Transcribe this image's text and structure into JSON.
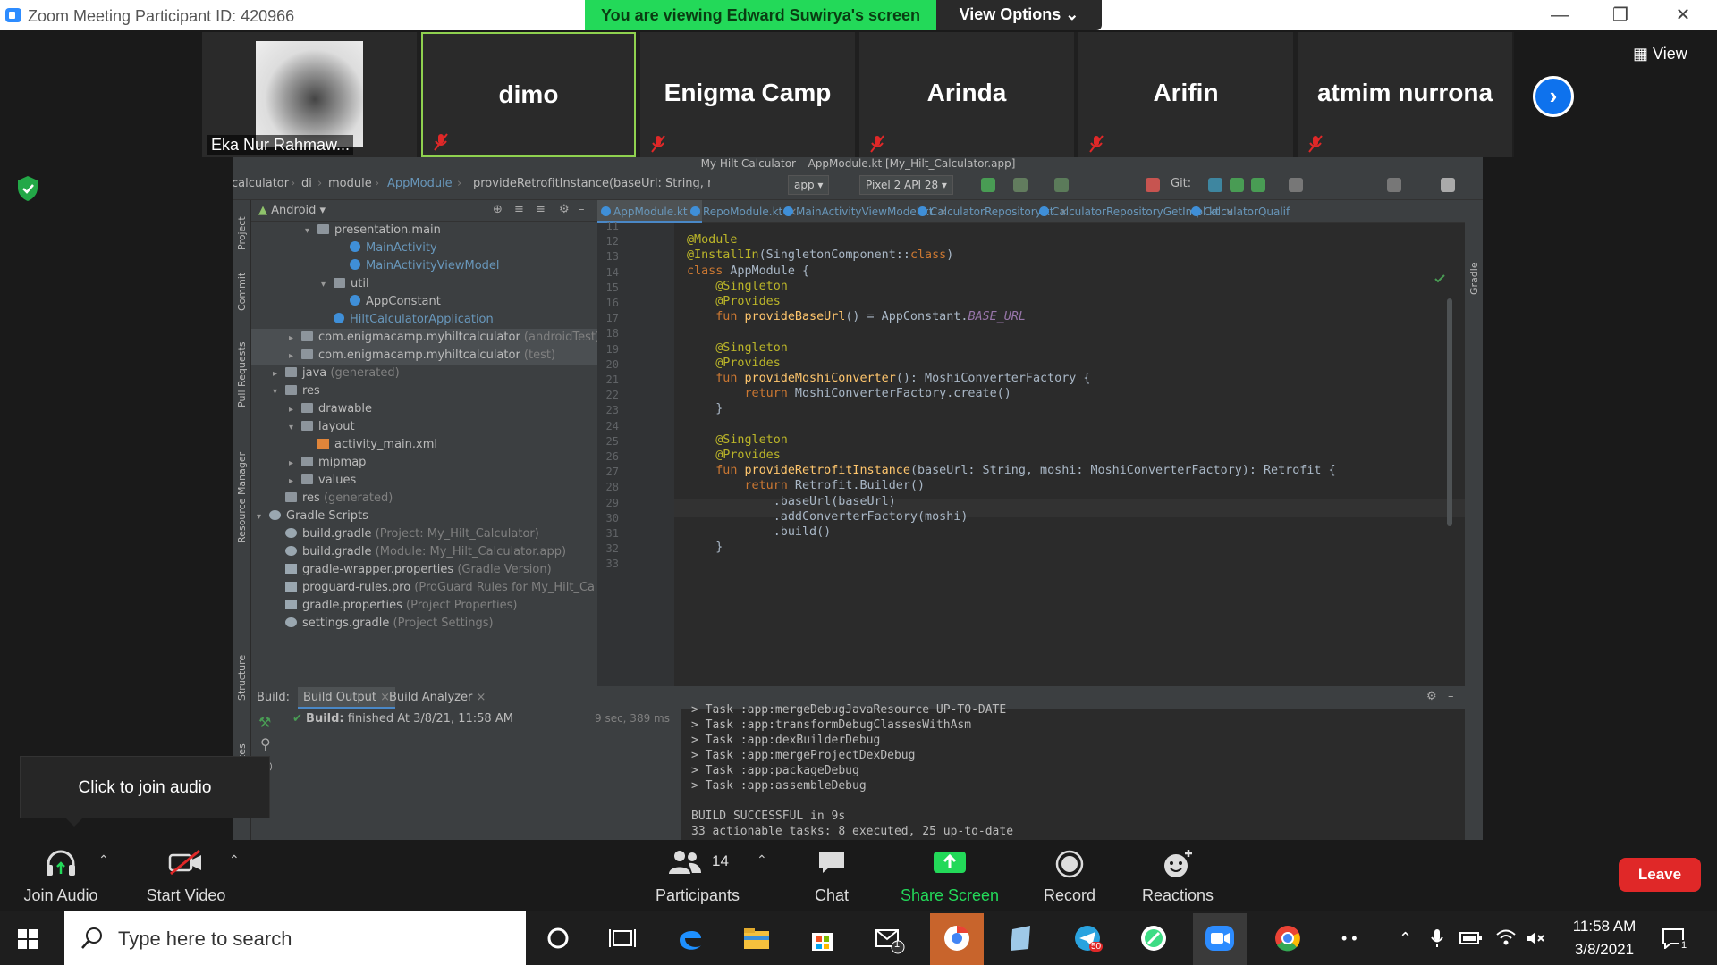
{
  "window": {
    "title": "Zoom Meeting Participant ID: 420966",
    "viewing_banner": "You are viewing Edward Suwirya's screen",
    "view_options": "View Options ⌄",
    "min": "—",
    "max": "❐",
    "close": "✕"
  },
  "participants": [
    {
      "name": "Eka Nur Rahmaw..."
    },
    {
      "name": "dimo"
    },
    {
      "name": "Enigma Camp"
    },
    {
      "name": "Arinda"
    },
    {
      "name": "Arifin"
    },
    {
      "name": "atmim nurrona"
    }
  ],
  "view_button": "View",
  "ide": {
    "title": "My Hilt Calculator – AppModule.kt [My_Hilt_Calculator.app]",
    "breadcrumbs": [
      "calculator",
      "di",
      "module",
      "AppModule",
      "provideRetrofitInstance(baseUrl: String, moshi:..."
    ],
    "run_config": "app",
    "device": "Pixel 2 API 28",
    "git_label": "Git:",
    "project_view": "Android",
    "tree": [
      {
        "label": "presentation.main",
        "note": "",
        "indent": 3,
        "arrow": "▾",
        "icon": "folder",
        "kt": false,
        "sel": false
      },
      {
        "label": "MainActivity",
        "note": "",
        "indent": 5,
        "arrow": "",
        "icon": "class",
        "kt": true,
        "sel": false
      },
      {
        "label": "MainActivityViewModel",
        "note": "",
        "indent": 5,
        "arrow": "",
        "icon": "class",
        "kt": true,
        "sel": false
      },
      {
        "label": "util",
        "note": "",
        "indent": 4,
        "arrow": "▾",
        "icon": "folder",
        "kt": false,
        "sel": false
      },
      {
        "label": "AppConstant",
        "note": "",
        "indent": 5,
        "arrow": "",
        "icon": "class",
        "kt": false,
        "sel": false
      },
      {
        "label": "HiltCalculatorApplication",
        "note": "",
        "indent": 4,
        "arrow": "",
        "icon": "class",
        "kt": true,
        "sel": false
      },
      {
        "label": "com.enigmacamp.myhiltcalculator",
        "note": " (androidTest)",
        "indent": 2,
        "arrow": "▸",
        "icon": "folder",
        "kt": false,
        "sel": true
      },
      {
        "label": "com.enigmacamp.myhiltcalculator",
        "note": " (test)",
        "indent": 2,
        "arrow": "▸",
        "icon": "folder",
        "kt": false,
        "sel": true
      },
      {
        "label": "java",
        "note": " (generated)",
        "indent": 1,
        "arrow": "▸",
        "icon": "folder",
        "kt": false,
        "sel": false
      },
      {
        "label": "res",
        "note": "",
        "indent": 1,
        "arrow": "▾",
        "icon": "folder",
        "kt": false,
        "sel": false
      },
      {
        "label": "drawable",
        "note": "",
        "indent": 2,
        "arrow": "▸",
        "icon": "folder",
        "kt": false,
        "sel": false
      },
      {
        "label": "layout",
        "note": "",
        "indent": 2,
        "arrow": "▾",
        "icon": "folder",
        "kt": false,
        "sel": false
      },
      {
        "label": "activity_main.xml",
        "note": "",
        "indent": 3,
        "arrow": "",
        "icon": "xml",
        "kt": false,
        "sel": false
      },
      {
        "label": "mipmap",
        "note": "",
        "indent": 2,
        "arrow": "▸",
        "icon": "folder",
        "kt": false,
        "sel": false
      },
      {
        "label": "values",
        "note": "",
        "indent": 2,
        "arrow": "▸",
        "icon": "folder",
        "kt": false,
        "sel": false
      },
      {
        "label": "res",
        "note": " (generated)",
        "indent": 1,
        "arrow": "",
        "icon": "folder",
        "kt": false,
        "sel": false
      },
      {
        "label": "Gradle Scripts",
        "note": "",
        "indent": 0,
        "arrow": "▾",
        "icon": "gradle",
        "kt": false,
        "sel": false
      },
      {
        "label": "build.gradle",
        "note": " (Project: My_Hilt_Calculator)",
        "indent": 1,
        "arrow": "",
        "icon": "gradle",
        "kt": false,
        "sel": false
      },
      {
        "label": "build.gradle",
        "note": " (Module: My_Hilt_Calculator.app)",
        "indent": 1,
        "arrow": "",
        "icon": "gradle",
        "kt": false,
        "sel": false
      },
      {
        "label": "gradle-wrapper.properties",
        "note": " (Gradle Version)",
        "indent": 1,
        "arrow": "",
        "icon": "props",
        "kt": false,
        "sel": false
      },
      {
        "label": "proguard-rules.pro",
        "note": " (ProGuard Rules for My_Hilt_Ca",
        "indent": 1,
        "arrow": "",
        "icon": "props",
        "kt": false,
        "sel": false
      },
      {
        "label": "gradle.properties",
        "note": " (Project Properties)",
        "indent": 1,
        "arrow": "",
        "icon": "props",
        "kt": false,
        "sel": false
      },
      {
        "label": "settings.gradle",
        "note": " (Project Settings)",
        "indent": 1,
        "arrow": "",
        "icon": "gradle",
        "kt": false,
        "sel": false
      }
    ],
    "tabs": [
      "AppModule.kt",
      "RepoModule.kt",
      "MainActivityViewModel.kt",
      "CalculatorRepository.kt",
      "CalculatorRepositoryGetImpl.kt",
      "CalculatorQualif"
    ],
    "code": [
      {
        "n": "11",
        "html": ""
      },
      {
        "n": "12",
        "html": "<span class='an'>@Module</span>"
      },
      {
        "n": "13",
        "html": "<span class='an'>@InstallIn</span>(SingletonComponent::<span class='kw'>class</span>)"
      },
      {
        "n": "14",
        "html": "<span class='kw'>class</span> AppModule {"
      },
      {
        "n": "15",
        "html": "    <span class='an'>@Singleton</span>"
      },
      {
        "n": "16",
        "html": "    <span class='an'>@Provides</span>"
      },
      {
        "n": "17",
        "html": "    <span class='kw'>fun</span> <span class='fn'>provideBaseUrl</span>() = AppConstant.<span class='cn'>BASE_URL</span>"
      },
      {
        "n": "18",
        "html": ""
      },
      {
        "n": "19",
        "html": "    <span class='an'>@Singleton</span>"
      },
      {
        "n": "20",
        "html": "    <span class='an'>@Provides</span>"
      },
      {
        "n": "21",
        "html": "    <span class='kw'>fun</span> <span class='fn'>provideMoshiConverter</span>(): MoshiConverterFactory {"
      },
      {
        "n": "22",
        "html": "        <span class='kw'>return</span> MoshiConverterFactory.create()"
      },
      {
        "n": "23",
        "html": "    }"
      },
      {
        "n": "24",
        "html": ""
      },
      {
        "n": "25",
        "html": "    <span class='an'>@Singleton</span>"
      },
      {
        "n": "26",
        "html": "    <span class='an'>@Provides</span>"
      },
      {
        "n": "27",
        "html": "    <span class='kw'>fun</span> <span class='fn'>provideRetrofitInstance</span>(baseUrl: String, moshi: MoshiConverterFactory): Retrofit {"
      },
      {
        "n": "28",
        "html": "        <span class='kw'>return</span> Retrofit.Builder()"
      },
      {
        "n": "29",
        "html": "            .baseUrl(baseUrl)"
      },
      {
        "n": "30",
        "html": "            .addConverterFactory(moshi)"
      },
      {
        "n": "31",
        "html": "            .build()"
      },
      {
        "n": "32",
        "html": "    }"
      },
      {
        "n": "33",
        "html": ""
      }
    ],
    "build": {
      "tab_prefix": "Build:",
      "tabs": [
        "Build Output",
        "Build Analyzer"
      ],
      "status_label": "Build:",
      "status_value": "finished",
      "status_time": "At 3/8/21, 11:58 AM",
      "duration": "9 sec, 389 ms",
      "output": [
        "> Task :app:mergeDebugJavaResource UP-TO-DATE",
        "> Task :app:transformDebugClassesWithAsm",
        "> Task :app:dexBuilderDebug",
        "> Task :app:mergeProjectDexDebug",
        "> Task :app:packageDebug",
        "> Task :app:assembleDebug",
        "",
        "BUILD SUCCESSFUL in 9s",
        "33 actionable tasks: 8 executed, 25 up-to-date"
      ]
    },
    "side_tools": [
      "Project",
      "Commit",
      "Pull Requests",
      "Resource Manager",
      "Structure",
      "Favorites"
    ],
    "right_tools": [
      "Gradle"
    ]
  },
  "tooltip": "Click to join audio",
  "controls": {
    "join_audio": "Join Audio",
    "start_video": "Start Video",
    "participants": "Participants",
    "participants_count": "14",
    "chat": "Chat",
    "share_screen": "Share Screen",
    "record": "Record",
    "reactions": "Reactions",
    "leave": "Leave"
  },
  "taskbar": {
    "search_placeholder": "Type here to search",
    "time": "11:58 AM",
    "date": "3/8/2021",
    "mail_badge": "1",
    "telegram_badge": "50",
    "notif_badge": "1"
  },
  "colors": {
    "zoom_blue": "#0e72ed",
    "banner_green": "#23d959",
    "leave_red": "#e02828",
    "share_green": "#23d959"
  }
}
